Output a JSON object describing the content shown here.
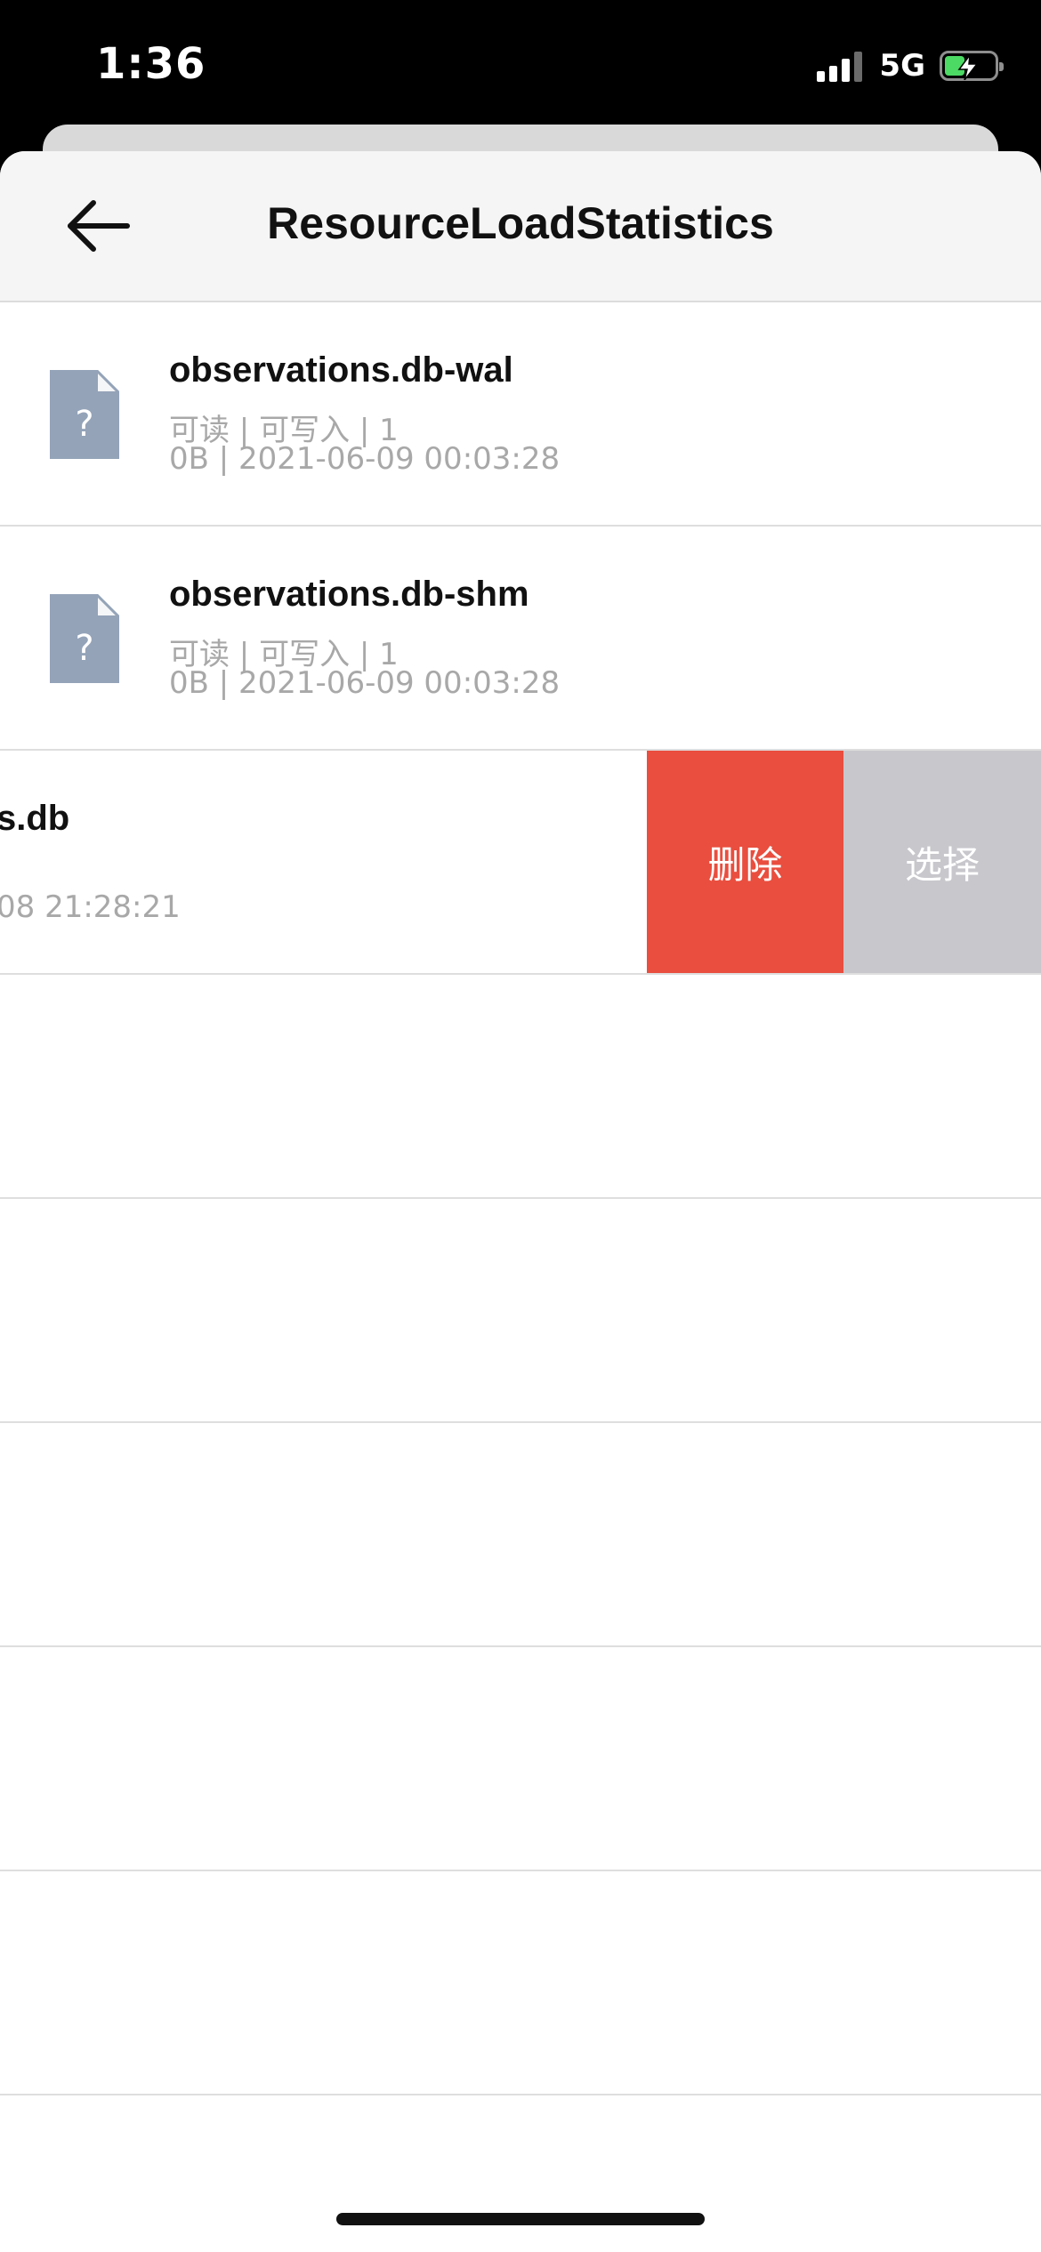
{
  "status_bar": {
    "time": "1:36",
    "network": "5G",
    "battery_level": 0.4,
    "battery_charging": true
  },
  "nav": {
    "title": "ResourceLoadStatistics",
    "back_icon": "arrow-left-icon"
  },
  "files": [
    {
      "name": "observations.db-wal",
      "permissions": "可读 | 可写入 | 1",
      "meta": "0B | 2021-06-09 00:03:28",
      "icon": "unknown-file-icon"
    },
    {
      "name": "observations.db-shm",
      "permissions": "可读 | 可写入 | 1",
      "meta": "0B | 2021-06-09 00:03:28",
      "icon": "unknown-file-icon"
    },
    {
      "name": "s.db",
      "meta": "08 21:28:21",
      "swiped": true
    }
  ],
  "swipe_actions": {
    "delete_label": "删除",
    "select_label": "选择",
    "delete_color": "#e94e3e",
    "select_color": "#c7c7cc"
  },
  "colors": {
    "file_icon": "#94a3b8",
    "nav_background": "#f5f5f5"
  }
}
